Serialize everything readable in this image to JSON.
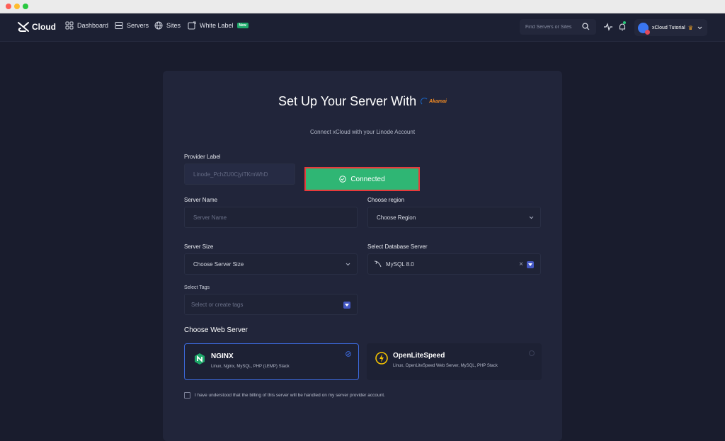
{
  "nav": {
    "logo": "Cloud",
    "items": [
      {
        "label": "Dashboard",
        "icon": "dashboard-icon"
      },
      {
        "label": "Servers",
        "icon": "servers-icon"
      },
      {
        "label": "Sites",
        "icon": "globe-icon"
      },
      {
        "label": "White Label",
        "icon": "white-label-icon",
        "badge": "New"
      }
    ],
    "search_placeholder": "Find Servers or Sites",
    "user_name": "xCloud Tutorial"
  },
  "page": {
    "title": "Set Up Your Server With",
    "provider_brand": "Akamai",
    "subtitle": "Connect xCloud with your Linode Account"
  },
  "form": {
    "provider_label": {
      "label": "Provider Label",
      "value": "Linode_PchZU0CjyiTKmWhD"
    },
    "connected_label": "Connected",
    "server_name": {
      "label": "Server Name",
      "placeholder": "Server Name"
    },
    "region": {
      "label": "Choose region",
      "value": "Choose Region"
    },
    "server_size": {
      "label": "Server Size",
      "value": "Choose Server Size"
    },
    "database": {
      "label": "Select Database Server",
      "value": "MySQL 8.0",
      "clear": "×"
    },
    "tags": {
      "label": "Select Tags",
      "placeholder": "Select or create tags"
    }
  },
  "web_server": {
    "title": "Choose Web Server",
    "options": [
      {
        "name": "NGINX",
        "desc": "Linux, Nginx, MySQL, PHP (LEMP) Stack",
        "selected": true
      },
      {
        "name": "OpenLiteSpeed",
        "desc": "Linux, OpenLiteSpeed Web Server, MySQL, PHP Stack",
        "selected": false
      }
    ]
  },
  "billing_checkbox": "I have understood that the billing of this server will be handled on my server provider account.",
  "colors": {
    "accent": "#2fb674",
    "highlight": "#e83a3a",
    "selected_border": "#3d6be0",
    "background": "#1a1d2e"
  }
}
